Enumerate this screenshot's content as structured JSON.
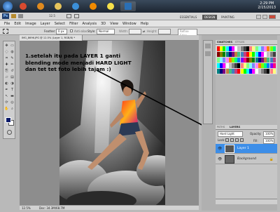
{
  "taskbar": {
    "apps": [
      {
        "icon": "chrome-icon",
        "color": "#d94a2f"
      },
      {
        "icon": "firefox-icon",
        "color": "#e08a1e"
      },
      {
        "icon": "folder-icon",
        "color": "#e6c45c"
      },
      {
        "icon": "ie-icon",
        "color": "#3b8fd8"
      },
      {
        "icon": "vlc-icon",
        "color": "#f08a00"
      },
      {
        "icon": "yahoo-messenger-icon",
        "color": "#f5e04a"
      },
      {
        "icon": "photoshop-icon",
        "color": "#2a6fb5"
      }
    ],
    "time": "2:29 PM",
    "date": "2/15/2013"
  },
  "appbar": {
    "logo": "Ps",
    "zoom": "12.5",
    "workspaces": [
      "ESSENTIALS",
      "DESIGN",
      "PAINTING"
    ],
    "active_workspace": "DESIGN"
  },
  "menu": [
    "File",
    "Edit",
    "Image",
    "Layer",
    "Select",
    "Filter",
    "Analysis",
    "3D",
    "View",
    "Window",
    "Help"
  ],
  "options": {
    "feather_label": "Feather:",
    "feather_value": "0 px",
    "antialias_label": "Anti-alias",
    "style_label": "Style:",
    "style_value": "Normal",
    "width_label": "Width:",
    "height_label": "Height:",
    "refine_edge": "Refine Edge..."
  },
  "document": {
    "tab_title": "IMG_8696.JPG @ 12.5% (Layer 1, RGB/8) *",
    "zoom_status": "12.5%",
    "doc_status": "Doc: 34.3M/68.7M"
  },
  "annotation": {
    "line1": "1.setelah itu pada LAYER 1 ganti",
    "line2": "blending mode menjadi HARD LIGHT",
    "line3": "dan tet tet foto lebih tajam :)"
  },
  "swatches_panel": {
    "tabs": [
      "SWATCHES",
      "STYLES"
    ],
    "colors": [
      "#ff0000",
      "#ffff00",
      "#00ff00",
      "#00ffff",
      "#0000ff",
      "#ff00ff",
      "#ffffff",
      "#c0c0c0",
      "#808080",
      "#404040",
      "#000000",
      "#ff8080",
      "#ffff80",
      "#80ff80",
      "#80ffff",
      "#8080ff",
      "#ff80ff",
      "#ff8000",
      "#80ff00",
      "#00ff80",
      "#0080ff",
      "#8000ff",
      "#ff0080",
      "#800000",
      "#808000",
      "#008000",
      "#008080",
      "#000080",
      "#800080",
      "#c08040",
      "#40c080",
      "#4080c0",
      "#c04080"
    ]
  },
  "layers_panel": {
    "tabs": [
      "PATHS",
      "LAYERS"
    ],
    "blend_mode": "Hard Light",
    "opacity_label": "Opacity:",
    "opacity_value": "100%",
    "lock_label": "Lock:",
    "fill_label": "Fill:",
    "fill_value": "100%",
    "layers": [
      {
        "name": "Layer 1",
        "selected": true
      },
      {
        "name": "Background",
        "selected": false
      }
    ]
  }
}
